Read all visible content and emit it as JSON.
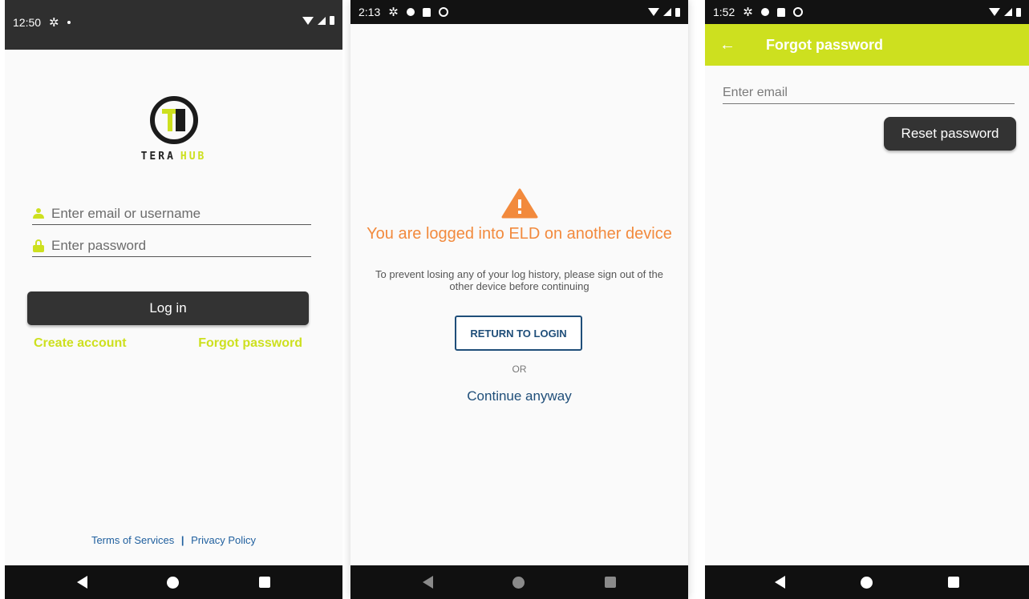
{
  "colors": {
    "accent": "#cde01f",
    "dark_button": "#333333",
    "warning": "#f28a3d",
    "link_blue": "#1f4e79"
  },
  "login_screen": {
    "status_time": "12:50",
    "logo_monogram": "TH",
    "logo_word1": "TERA",
    "logo_word2": "HUB",
    "email_placeholder": "Enter email or username",
    "password_placeholder": "Enter password",
    "login_label": "Log in",
    "create_account": "Create account",
    "forgot_password": "Forgot password",
    "terms": "Terms of Services",
    "separator": "|",
    "privacy": "Privacy Policy"
  },
  "logged_in_screen": {
    "status_time": "2:13",
    "title": "You are logged into ELD on another device",
    "subtitle": "To prevent losing any of your log history, please sign out of the other device before continuing",
    "return_label": "RETURN TO LOGIN",
    "or": "OR",
    "continue_label": "Continue anyway"
  },
  "forgot_screen": {
    "status_time": "1:52",
    "title": "Forgot password",
    "email_placeholder": "Enter email",
    "reset_label": "Reset password"
  }
}
